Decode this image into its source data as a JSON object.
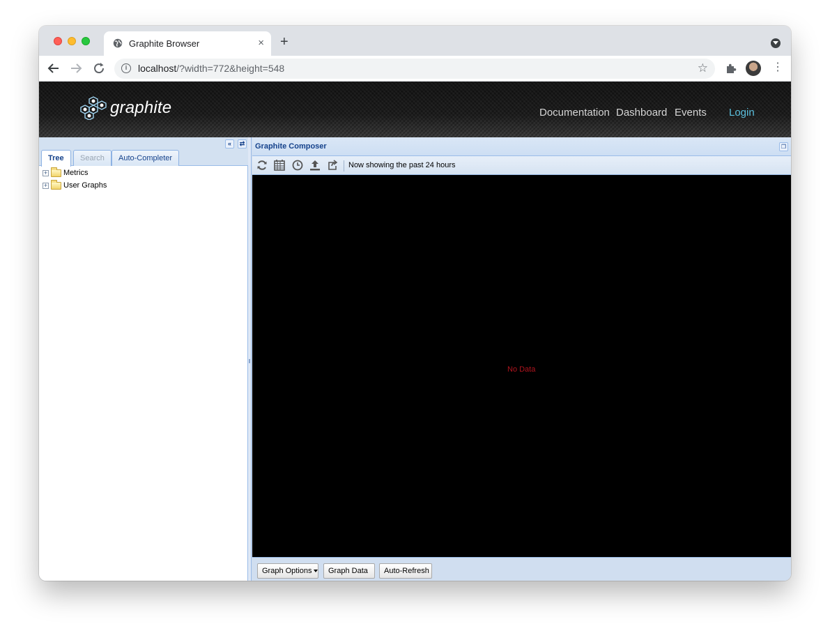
{
  "browser": {
    "tab_title": "Graphite Browser",
    "tab_close": "×",
    "new_tab": "+",
    "url_host": "localhost",
    "url_path": "/?width=772&height=548",
    "star": "☆",
    "kebab": "⋮"
  },
  "header": {
    "logo_text": "graphite",
    "nav": {
      "documentation": "Documentation",
      "dashboard": "Dashboard",
      "events": "Events",
      "login": "Login"
    }
  },
  "left_panel": {
    "tabs": {
      "tree": "Tree",
      "search": "Search",
      "auto_completer": "Auto-Completer"
    },
    "tree": {
      "items": [
        {
          "label": "Metrics"
        },
        {
          "label": "User Graphs"
        }
      ]
    }
  },
  "composer": {
    "title": "Graphite Composer",
    "status": "Now showing the past 24 hours",
    "no_data": "No Data",
    "buttons": {
      "graph_options": "Graph Options",
      "graph_data": "Graph Data",
      "auto_refresh": "Auto-Refresh"
    }
  },
  "colors": {
    "login_link": "#5bc0de",
    "panel_accent": "#15428b",
    "no_data": "#b0141e"
  }
}
